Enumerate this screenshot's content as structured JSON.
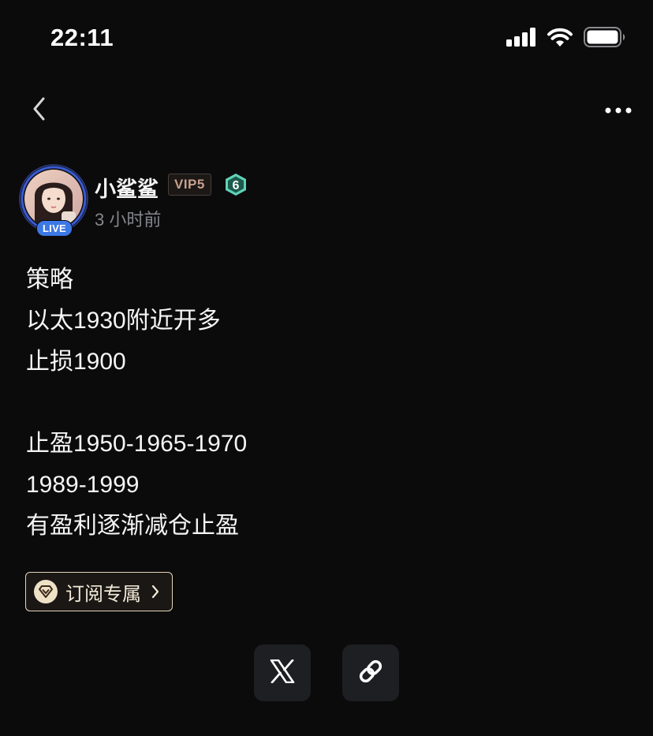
{
  "status_bar": {
    "time": "22:11",
    "icons": [
      "cellular-signal-icon",
      "wifi-icon",
      "battery-icon"
    ]
  },
  "nav": {
    "icons": [
      "back-chevron-icon",
      "more-dots-icon"
    ]
  },
  "author": {
    "name": "小鲨鲨",
    "vip": "VIP5",
    "level": "6",
    "live_label": "LIVE",
    "time_ago": "3 小时前"
  },
  "post": {
    "lines": [
      "策略",
      "以太1930附近开多",
      "止损1900",
      "",
      "止盈1950-1965-1970",
      "1989-1999",
      "有盈利逐渐减仓止盈"
    ]
  },
  "subscribe": {
    "label": "订阅专属",
    "icon": "diamond-heart-icon"
  },
  "share": {
    "icons": [
      "x-logo-icon",
      "link-icon"
    ]
  },
  "colors": {
    "background": "#0b0b0c",
    "text": "#f5f5f5",
    "muted": "#85878c",
    "vip": "#c7a08d",
    "level": "#5fd3b8",
    "live": "#3c78e6",
    "gold": "#e7d6b8"
  }
}
